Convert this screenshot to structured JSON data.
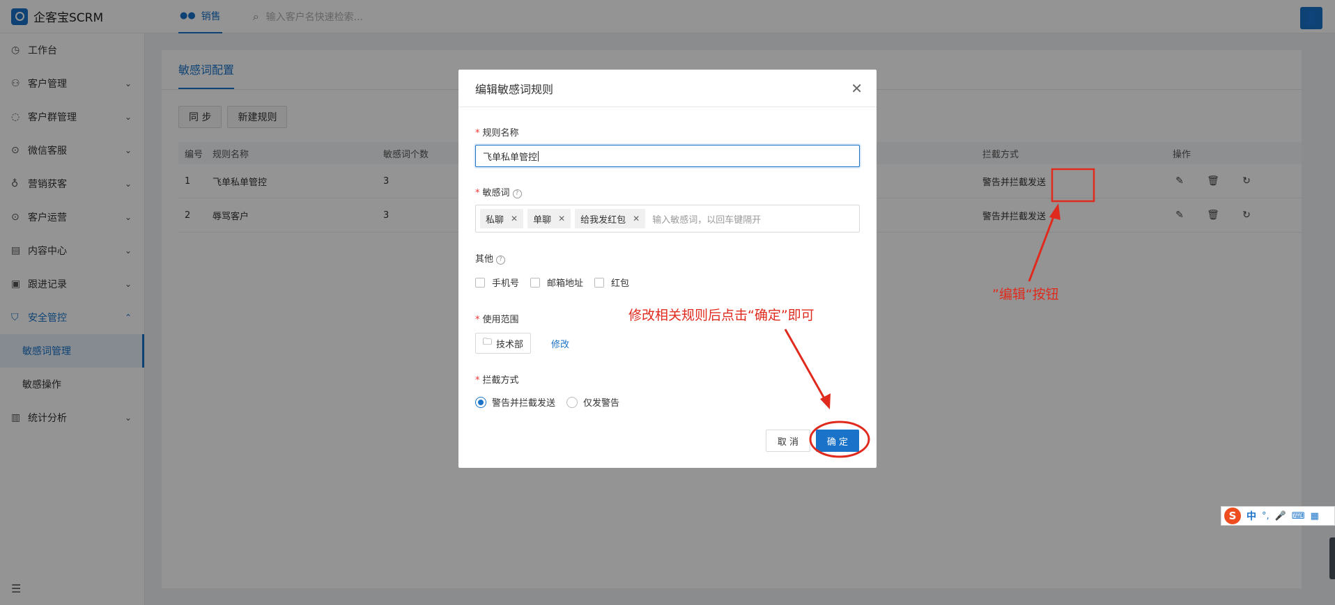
{
  "app": {
    "brand_name": "企客宝SCRM",
    "top_tab": "销售",
    "search_placeholder": "输入客户名快速检索..."
  },
  "sidebar": {
    "items": [
      {
        "label": "工作台",
        "icon": "dashboard-icon"
      },
      {
        "label": "客户管理",
        "icon": "user-group-icon"
      },
      {
        "label": "客户群管理",
        "icon": "chat-icon"
      },
      {
        "label": "微信客服",
        "icon": "wechat-icon"
      },
      {
        "label": "营销获客",
        "icon": "bulb-icon"
      },
      {
        "label": "客户运营",
        "icon": "ops-icon"
      },
      {
        "label": "内容中心",
        "icon": "content-icon"
      },
      {
        "label": "跟进记录",
        "icon": "record-icon"
      },
      {
        "label": "安全管控",
        "icon": "shield-icon"
      }
    ],
    "sub_items": [
      "敏感词管理",
      "敏感操作"
    ],
    "last_item": {
      "label": "统计分析",
      "icon": "chart-icon"
    }
  },
  "page": {
    "tab": "敏感词配置",
    "buttons": [
      "同 步",
      "新建规则"
    ],
    "columns": [
      "编号",
      "规则名称",
      "敏感词个数",
      "拦截方式",
      "操作"
    ],
    "rows": [
      {
        "id": "1",
        "name": "飞单私单管控",
        "count": "3",
        "mode": "警告并拦截发送"
      },
      {
        "id": "2",
        "name": "辱骂客户",
        "count": "3",
        "mode": "警告并拦截发送"
      }
    ]
  },
  "modal": {
    "title": "编辑敏感词规则",
    "name_label": "规则名称",
    "name_value": "飞单私单管控",
    "words_label": "敏感词",
    "tags": [
      "私聊",
      "单聊",
      "给我发红包"
    ],
    "words_placeholder": "输入敏感词，以回车键隔开",
    "other_label": "其他",
    "checks": [
      "手机号",
      "邮箱地址",
      "红包"
    ],
    "scope_label": "使用范围",
    "scope_dept": "技术部",
    "scope_edit": "修改",
    "mode_label": "拦截方式",
    "modes": [
      "警告并拦截发送",
      "仅发警告"
    ],
    "cancel": "取 消",
    "ok": "确 定"
  },
  "annotations": {
    "edit_hint": "”编辑“按钮",
    "confirm_hint": "修改相关规则后点击“确定”即可",
    "color": "#e02a1e"
  },
  "ime": {
    "mode": "中",
    "punct": "°,"
  }
}
